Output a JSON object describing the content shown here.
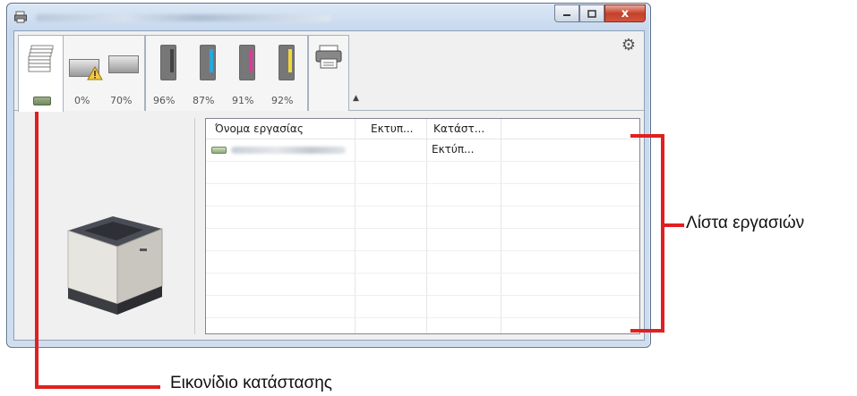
{
  "window": {
    "close_glyph": "x"
  },
  "tabs": {
    "tray1_pct": "0%",
    "tray2_pct": "70%",
    "toner": [
      {
        "pct": "96%",
        "color": "#444444"
      },
      {
        "pct": "87%",
        "color": "#29a8df"
      },
      {
        "pct": "91%",
        "color": "#e0399a"
      },
      {
        "pct": "92%",
        "color": "#f1d83a"
      }
    ]
  },
  "job_list": {
    "columns": [
      "Όνομα εργασίας",
      "Εκτυπ...",
      "Κατάστ..."
    ],
    "rows": [
      {
        "status": "Εκτύπ..."
      }
    ]
  },
  "annotations": {
    "job_list_label": "Λίστα εργασιών",
    "status_icon_label": "Εικονίδιο κατάστασης",
    "callout_color": "#e02020"
  }
}
